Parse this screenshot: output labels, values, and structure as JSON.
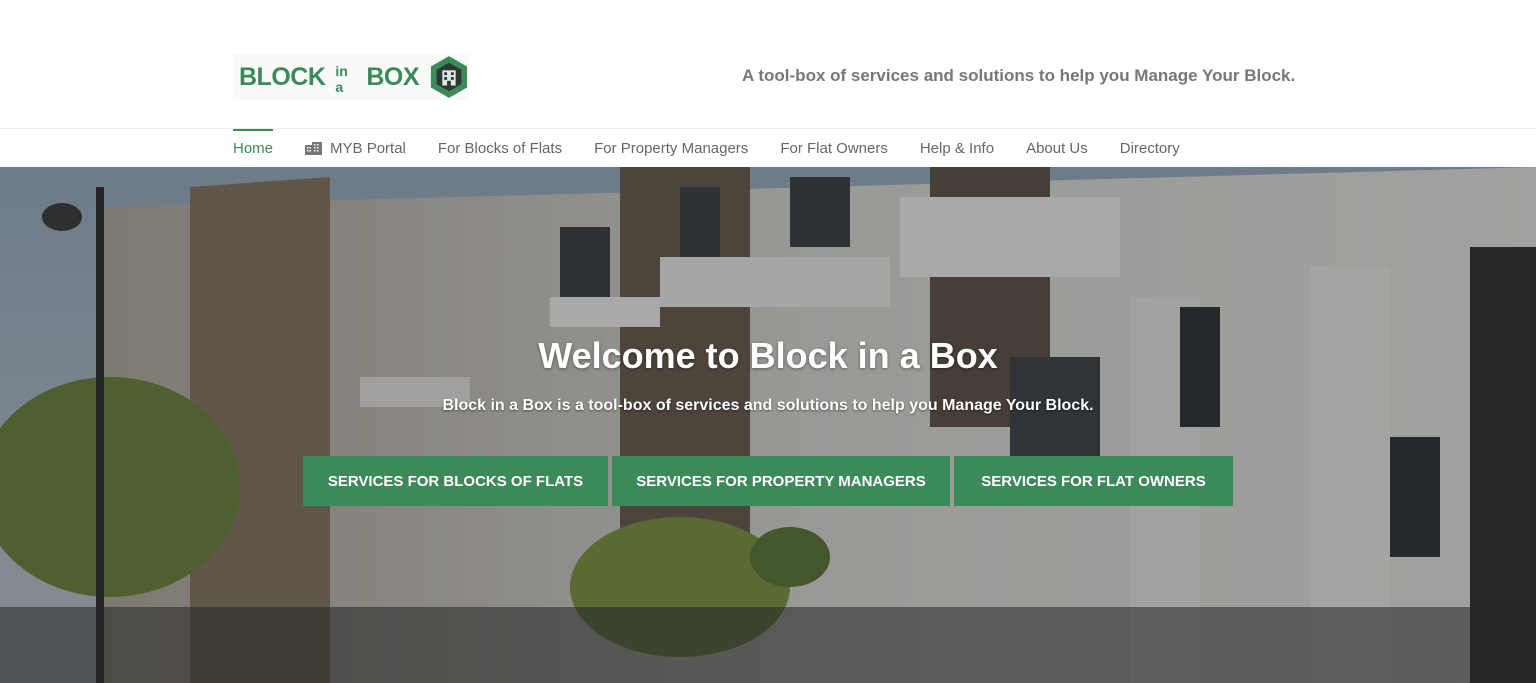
{
  "logo": {
    "word1": "BLOCK",
    "word2": "in a",
    "word3": "BOX"
  },
  "tagline": "A tool-box of services and solutions to help you Manage Your Block.",
  "nav": {
    "items": [
      {
        "label": "Home",
        "active": true
      },
      {
        "label": "MYB Portal",
        "icon": "building-icon"
      },
      {
        "label": "For Blocks of Flats"
      },
      {
        "label": "For Property Managers"
      },
      {
        "label": "For Flat Owners"
      },
      {
        "label": "Help & Info"
      },
      {
        "label": "About Us"
      },
      {
        "label": "Directory"
      }
    ]
  },
  "hero": {
    "title": "Welcome to Block in a Box",
    "subtitle": "Block in a Box is a tool-box of services and solutions to help you Manage Your Block.",
    "buttons": [
      {
        "label": "SERVICES FOR BLOCKS OF FLATS"
      },
      {
        "label": "SERVICES FOR PROPERTY MANAGERS"
      },
      {
        "label": "SERVICES FOR FLAT OWNERS"
      }
    ]
  },
  "colors": {
    "brand": "#3c8a5a",
    "tagline": "#777777",
    "nav_text": "#666666"
  }
}
